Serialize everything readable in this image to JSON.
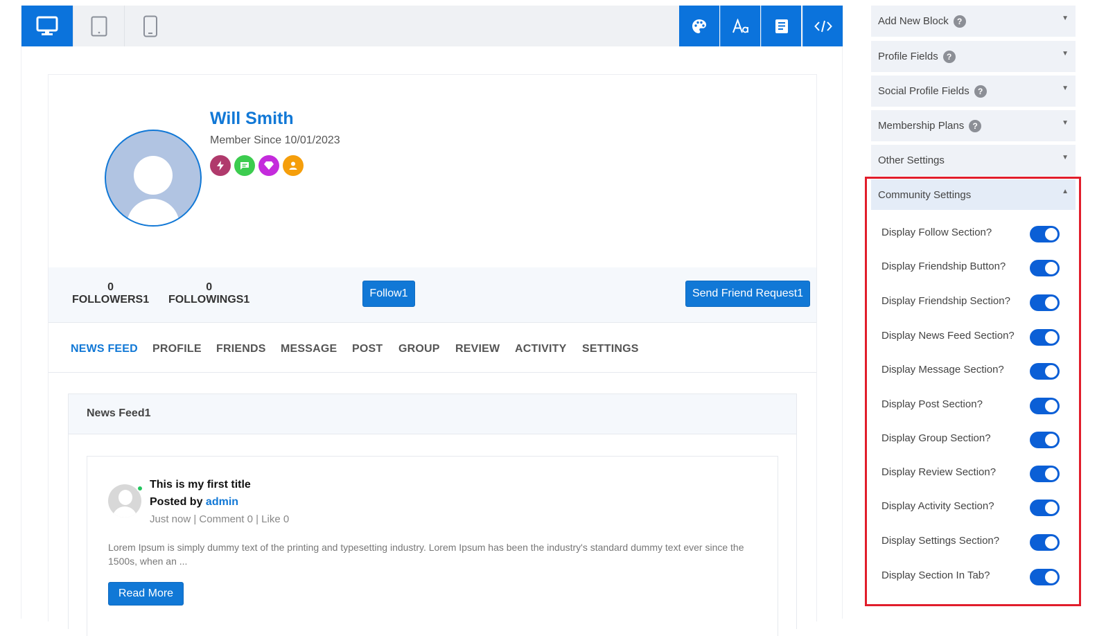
{
  "toolbar": {
    "devices": [
      {
        "icon": "desktop-icon",
        "active": true
      },
      {
        "icon": "tablet-icon",
        "active": false
      },
      {
        "icon": "mobile-icon",
        "active": false
      }
    ],
    "tools": [
      "palette-icon",
      "typography-icon",
      "document-icon",
      "code-icon"
    ]
  },
  "profile": {
    "name": "Will Smith",
    "member_since": "Member Since 10/01/2023",
    "badges": [
      {
        "icon": "lightning-icon",
        "color": "#b03a6c"
      },
      {
        "icon": "chat-icon",
        "color": "#3ccc4f"
      },
      {
        "icon": "diamond-icon",
        "color": "#c42bdc"
      },
      {
        "icon": "user-icon",
        "color": "#f59e0b"
      }
    ]
  },
  "stats": {
    "followers_count": "0",
    "followers_label": "FOLLOWERS1",
    "followings_count": "0",
    "followings_label": "FOLLOWINGS1",
    "follow_button": "Follow1",
    "friend_button": "Send Friend Request1"
  },
  "tabs": [
    "NEWS FEED",
    "PROFILE",
    "FRIENDS",
    "MESSAGE",
    "POST",
    "GROUP",
    "REVIEW",
    "ACTIVITY",
    "SETTINGS"
  ],
  "feed": {
    "heading": "News Feed1",
    "post": {
      "title": "This is my first title",
      "posted_by": "Posted by",
      "author": "admin",
      "meta": "Just now | Comment 0 | Like 0",
      "excerpt": "Lorem Ipsum is simply dummy text of the printing and typesetting industry. Lorem Ipsum has been the industry's standard dummy text ever since the 1500s, when an ...",
      "read_more": "Read More"
    }
  },
  "panel": {
    "sections": [
      "Add New Block",
      "Profile Fields",
      "Social Profile Fields",
      "Membership Plans",
      "Other Settings"
    ],
    "help_glyph": "?",
    "community": {
      "title": "Community Settings",
      "settings": [
        {
          "label": "Display Follow Section?",
          "on": true
        },
        {
          "label": "Display Friendship Button?",
          "on": true
        },
        {
          "label": "Display Friendship Section?",
          "on": true
        },
        {
          "label": "Display News Feed Section?",
          "on": true
        },
        {
          "label": "Display Message Section?",
          "on": true
        },
        {
          "label": "Display Post Section?",
          "on": true
        },
        {
          "label": "Display Group Section?",
          "on": true
        },
        {
          "label": "Display Review Section?",
          "on": true
        },
        {
          "label": "Display Activity Section?",
          "on": true
        },
        {
          "label": "Display Settings Section?",
          "on": true
        },
        {
          "label": "Display Section In Tab?",
          "on": true
        }
      ]
    }
  }
}
